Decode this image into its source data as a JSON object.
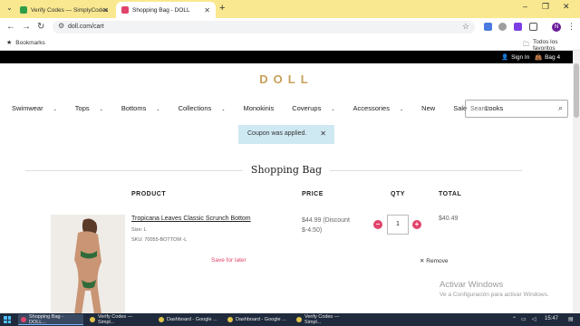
{
  "browser": {
    "tabs": [
      {
        "title": "Verify Codes — SimplyCodes",
        "active": false,
        "favicon_color": "#2e9d48"
      },
      {
        "title": "Shopping Bag - DOLL",
        "active": true,
        "favicon_color": "#e0446a"
      }
    ],
    "url": "doll.com/cart",
    "bookmarks_label": "Bookmarks",
    "all_bookmarks_label": "Todos los favoritos"
  },
  "site": {
    "sign_in": "Sign In",
    "bag": "Bag 4",
    "logo": "DOLL",
    "nav": [
      "Swimwear",
      "Tops",
      "Bottoms",
      "Collections",
      "Monokinis",
      "Coverups",
      "Accessories",
      "New",
      "Sale",
      "Looks"
    ],
    "nav_has_dropdown": [
      true,
      true,
      true,
      true,
      false,
      true,
      true,
      false,
      false,
      false
    ],
    "search_placeholder": "Search",
    "notice": "Coupon was applied.",
    "page_title": "Shopping Bag",
    "columns": {
      "product": "PRODUCT",
      "price": "PRICE",
      "qty": "QTY",
      "total": "TOTAL"
    },
    "item": {
      "name": "Tropicana Leaves Classic Scrunch Bottom",
      "size": "Size: L",
      "sku": "SKU: 70055-BOTTOM -L",
      "price": "$44.99 (Discount $-4.50)",
      "qty": "1",
      "total": "$40.49",
      "save_for_later": "Save for later",
      "remove": "Remove"
    },
    "accent_color": "#e0446a",
    "logo_color": "#c8a05a"
  },
  "watermark": {
    "line1": "Activar Windows",
    "line2": "Ve a Configuración para activar Windows."
  },
  "taskbar": {
    "items": [
      {
        "title": "Shopping Bag - DOLL...",
        "active": true
      },
      {
        "title": "Verify Codes — Simpl...",
        "active": false
      },
      {
        "title": "Dashboard - Google ...",
        "active": false
      },
      {
        "title": "Dashboard - Google ...",
        "active": false
      },
      {
        "title": "Verify Codes — Simpl...",
        "active": false
      }
    ],
    "time": "15:47"
  }
}
